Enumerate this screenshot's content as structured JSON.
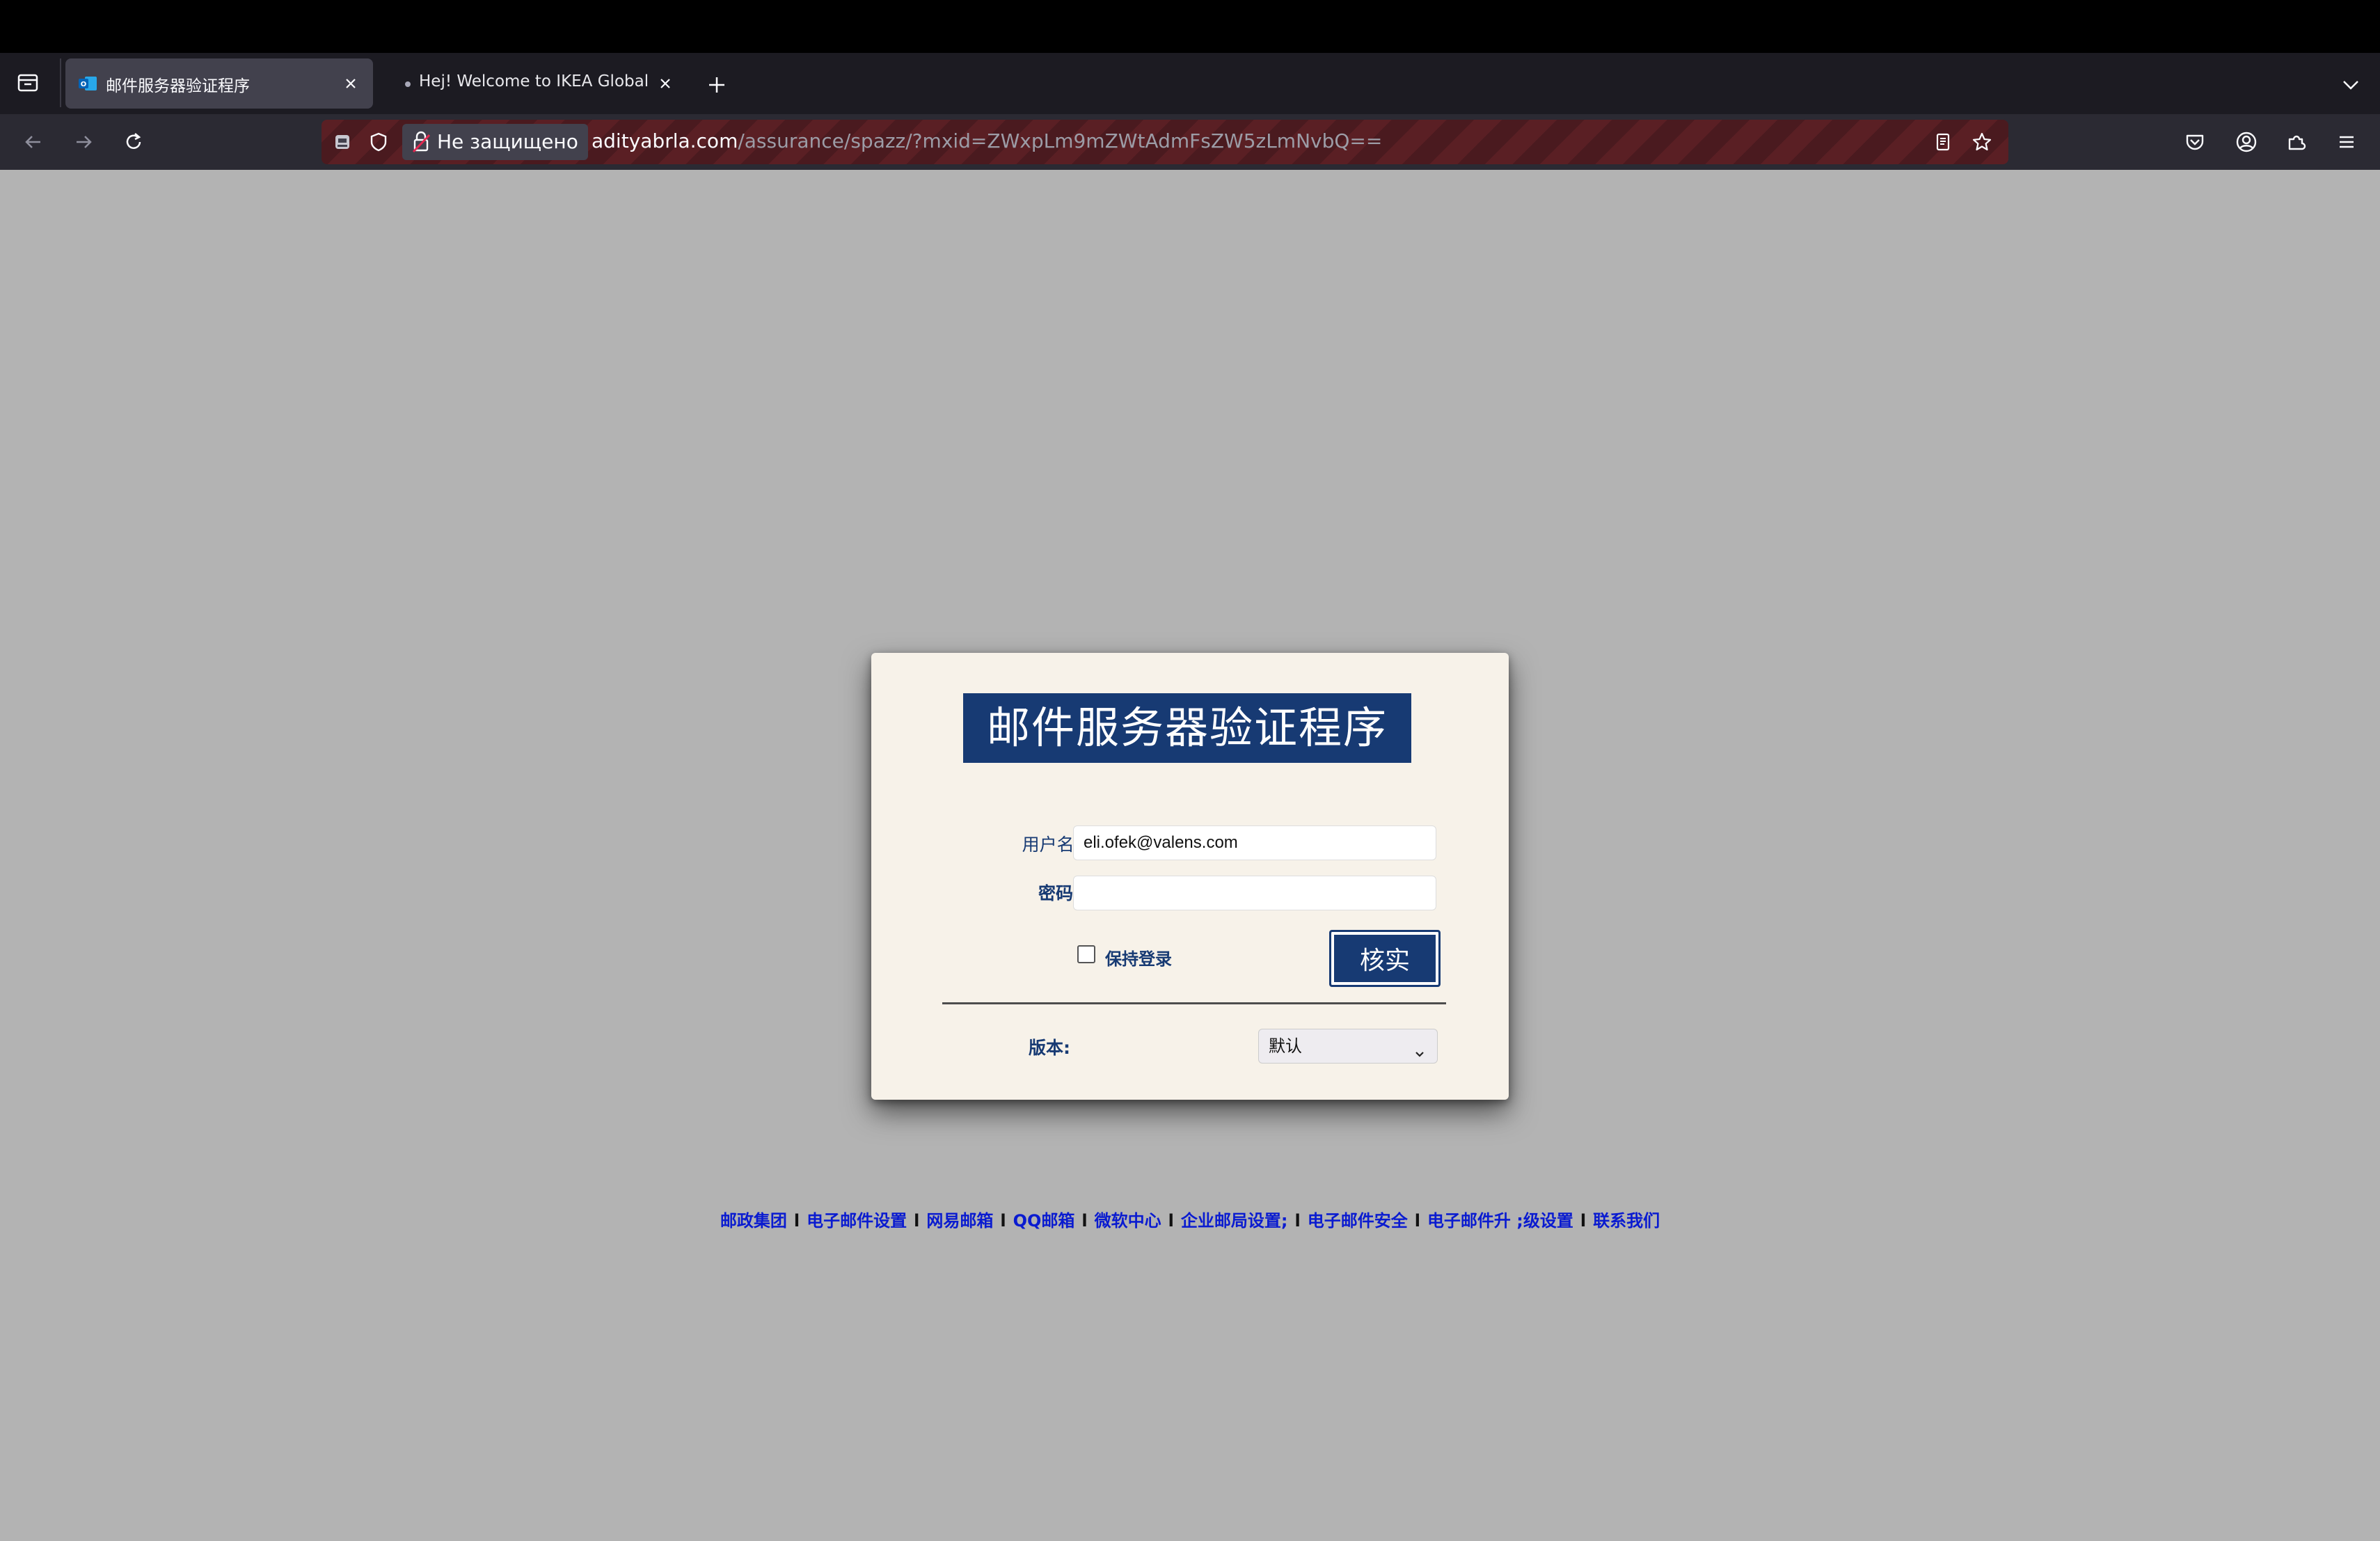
{
  "browser": {
    "tabs": [
      {
        "title": "邮件服务器验证程序",
        "active": true,
        "favicon": "outlook-icon"
      },
      {
        "title": "Hej! Welcome to IKEA Global",
        "active": false
      }
    ],
    "security_label": "Не защищено",
    "url_host": "adityabrla.com",
    "url_path": "/assurance/spazz/?mxid=ZWxpLm9mZWtAdmFsZW5zLmNvbQ=="
  },
  "form": {
    "title": "邮件服务器验证程序",
    "username_label": "用户名:",
    "username_value": "eli.ofek@valens.com",
    "password_label": "密码:",
    "password_value": "",
    "keep_signed_in_label": "保持登录",
    "keep_signed_in_checked": false,
    "verify_button": "核实",
    "version_label": "版本:",
    "version_selected": "默认"
  },
  "footer": {
    "links": [
      "邮政集团",
      "电子邮件设置",
      "网易邮箱",
      "QQ邮箱",
      "微软中心",
      "企业邮局设置;",
      "电子邮件安全",
      "电子邮件升 ;级设置",
      "联系我们"
    ],
    "separator": "l"
  },
  "colors": {
    "page_bg": "#b3b3b3",
    "card_bg": "#f7f2e9",
    "brand_blue": "#173a73",
    "link_blue": "#0a1bd0"
  }
}
